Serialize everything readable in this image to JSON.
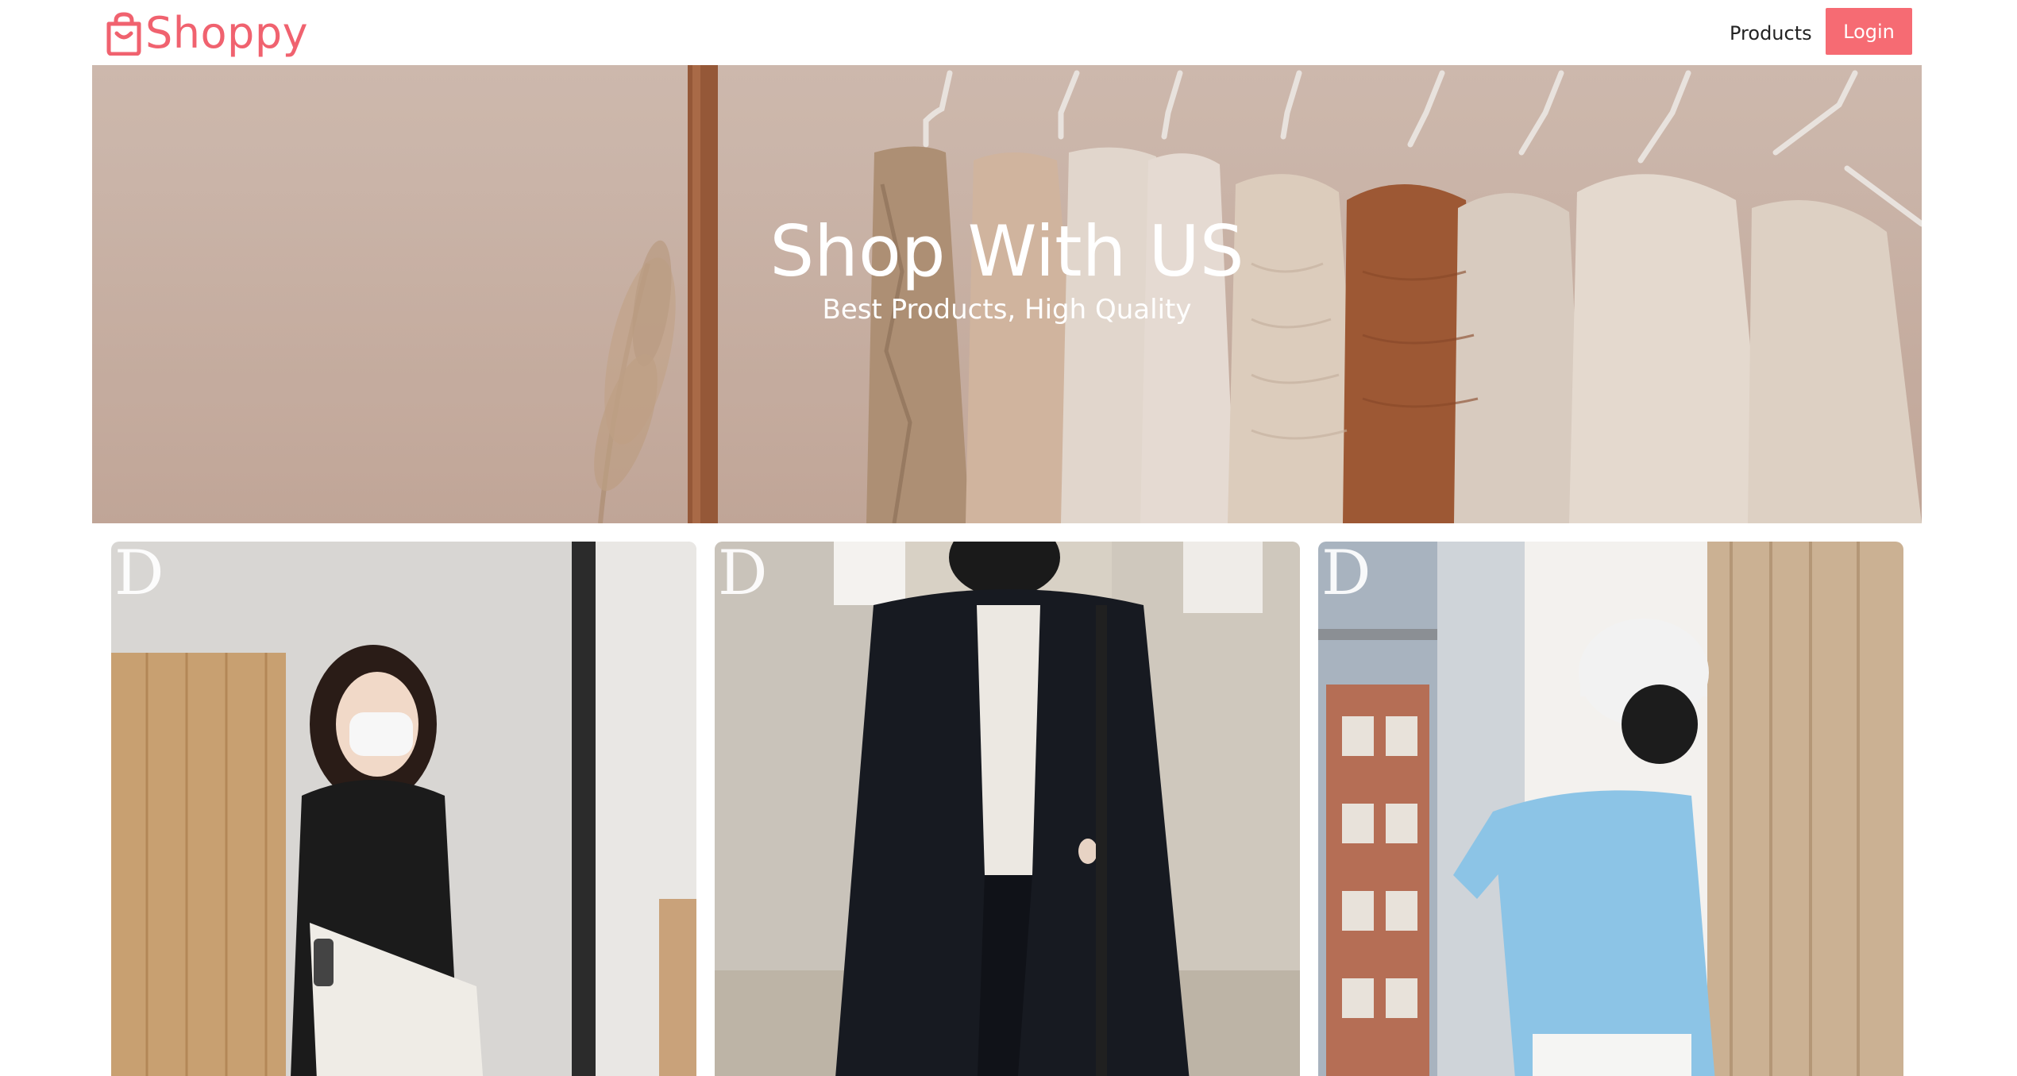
{
  "app": {
    "brand_name": "Shoppy",
    "brand_color": "#f0626f",
    "brand_icon": "shopping-bag-icon"
  },
  "nav": {
    "products_label": "Products",
    "login_label": "Login",
    "login_color": "#f66b73"
  },
  "hero": {
    "title": "Shop With US",
    "subtitle": "Best Products, High Quality"
  },
  "products": [
    {
      "mark": "D"
    },
    {
      "mark": "D"
    },
    {
      "mark": "D"
    }
  ]
}
